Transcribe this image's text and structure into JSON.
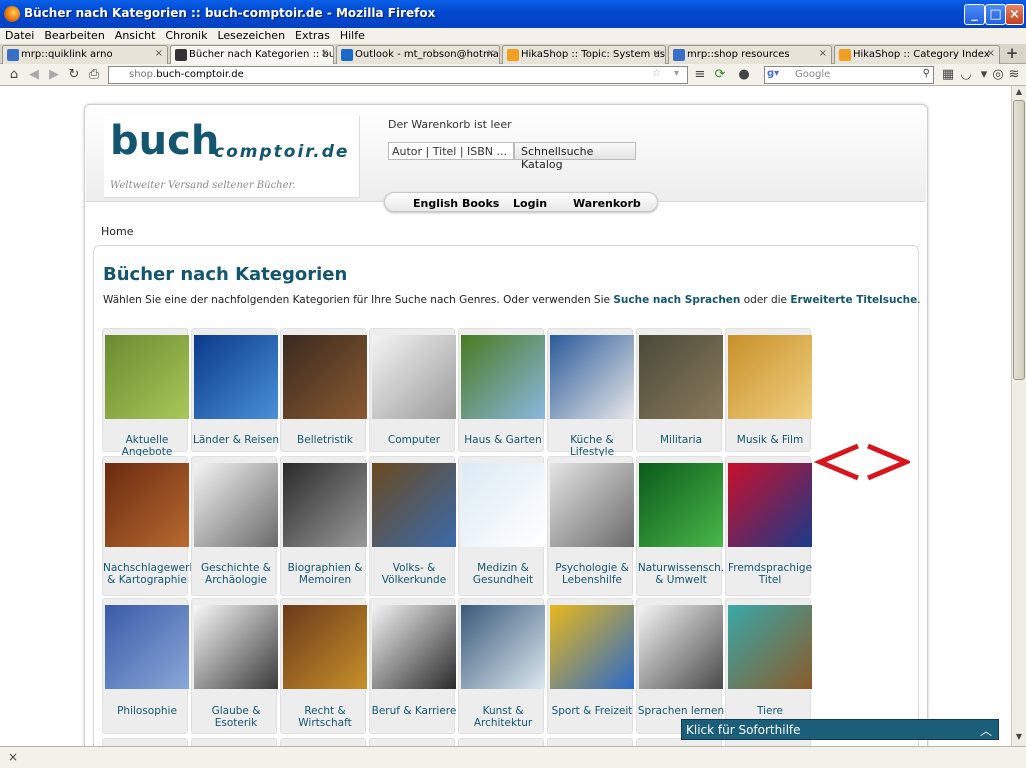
{
  "window": {
    "title": "Bücher nach Kategorien :: buch-comptoir.de - Mozilla Firefox"
  },
  "menu": [
    "Datei",
    "Bearbeiten",
    "Ansicht",
    "Chronik",
    "Lesezeichen",
    "Extras",
    "Hilfe"
  ],
  "tabs": [
    {
      "label": "mrp::quiklink arno",
      "color": "#3a6fc8"
    },
    {
      "label": "Bücher nach Kategorien :: buc...",
      "color": "#333333"
    },
    {
      "label": "Outlook - mt_robson@hotmail....",
      "color": "#1b6ac9"
    },
    {
      "label": "HikaShop :: Topic: System usi...",
      "color": "#f0a020"
    },
    {
      "label": "mrp::shop resources",
      "color": "#3a6fc8"
    },
    {
      "label": "HikaShop :: Category Index",
      "color": "#f0a020"
    }
  ],
  "nav": {
    "url_prefix": "shop.",
    "url_domain": "buch-comptoir.de",
    "search_placeholder": "Google"
  },
  "shop": {
    "logo_big": "buch",
    "logo_small": "comptoir.de",
    "logo_tagline": "Weltweiter Versand seltener Bücher.",
    "cart_status": "Der Warenkorb ist leer",
    "quicksearch_value": "Autor | Titel | ISBN ...",
    "quicksearch_button": "Schnellsuche Katalog",
    "nav_english": "English Books",
    "nav_login": "Login",
    "nav_cart": "Warenkorb",
    "breadcrumb": "Home",
    "page_title": "Bücher nach Kategorien",
    "intro_text": "Wählen Sie eine der nachfolgenden Kategorien für Ihre Suche nach Genres. Oder verwenden Sie ",
    "intro_link1": "Suche nach Sprachen",
    "intro_mid": " oder die ",
    "intro_link2": "Erweiterte Titelsuche",
    "intro_end": ".",
    "help_label": "Klick für Soforthilfe"
  },
  "categories": [
    {
      "label": "Aktuelle Angebote",
      "c1": "#6a8a30",
      "c2": "#a9c85a"
    },
    {
      "label": "Länder & Reisen",
      "c1": "#0a3a8a",
      "c2": "#4a90d8"
    },
    {
      "label": "Belletristik",
      "c1": "#3a2a20",
      "c2": "#8a5a30"
    },
    {
      "label": "Computer",
      "c1": "#f4f4f4",
      "c2": "#9a9a9a"
    },
    {
      "label": "Haus & Garten",
      "c1": "#4a7a20",
      "c2": "#8ab8e0"
    },
    {
      "label": "Küche & Lifestyle",
      "c1": "#2a5a9a",
      "c2": "#e8e8e8"
    },
    {
      "label": "Militaria",
      "c1": "#4a4a3a",
      "c2": "#8a7a5a"
    },
    {
      "label": "Musik & Film",
      "c1": "#c8902a",
      "c2": "#f0d080"
    },
    {
      "label": "Nachschlagewerke & Kartographie",
      "c1": "#6a2a10",
      "c2": "#b86a30"
    },
    {
      "label": "Geschichte & Archäologie",
      "c1": "#f4f4f4",
      "c2": "#6a6a6a"
    },
    {
      "label": "Biographien & Memoiren",
      "c1": "#2a2a2a",
      "c2": "#9a9a9a"
    },
    {
      "label": "Volks- & Völkerkunde",
      "c1": "#6a4a20",
      "c2": "#3a6aaa"
    },
    {
      "label": "Medizin & Gesundheit",
      "c1": "#dceaf4",
      "c2": "#ffffff"
    },
    {
      "label": "Psychologie & Lebenshilfe",
      "c1": "#e4e4e4",
      "c2": "#6a6a6a"
    },
    {
      "label": "Naturwissensch. & Umwelt",
      "c1": "#0a5a1a",
      "c2": "#4ab84a"
    },
    {
      "label": "Fremdsprachige Titel",
      "c1": "#c8102a",
      "c2": "#1a3a8a"
    },
    {
      "label": "Philosophie",
      "c1": "#3a5aa8",
      "c2": "#8aa8d8"
    },
    {
      "label": "Glaube & Esoterik",
      "c1": "#f8f8f8",
      "c2": "#3a3a3a"
    },
    {
      "label": "Recht & Wirtschaft",
      "c1": "#6a3a1a",
      "c2": "#c8902a"
    },
    {
      "label": "Beruf & Karriere",
      "c1": "#f4f4f4",
      "c2": "#2a2a2a"
    },
    {
      "label": "Kunst & Architektur",
      "c1": "#3a5a7a",
      "c2": "#dce8f0"
    },
    {
      "label": "Sport & Freizeit",
      "c1": "#e8b81a",
      "c2": "#2a6aca"
    },
    {
      "label": "Sprachen lernen",
      "c1": "#f4f4f4",
      "c2": "#4a4a4a"
    },
    {
      "label": "Tiere",
      "c1": "#3aa8a8",
      "c2": "#8a5a2a"
    }
  ],
  "colors": {
    "accent": "#13566e",
    "arrow": "#d8141c"
  }
}
